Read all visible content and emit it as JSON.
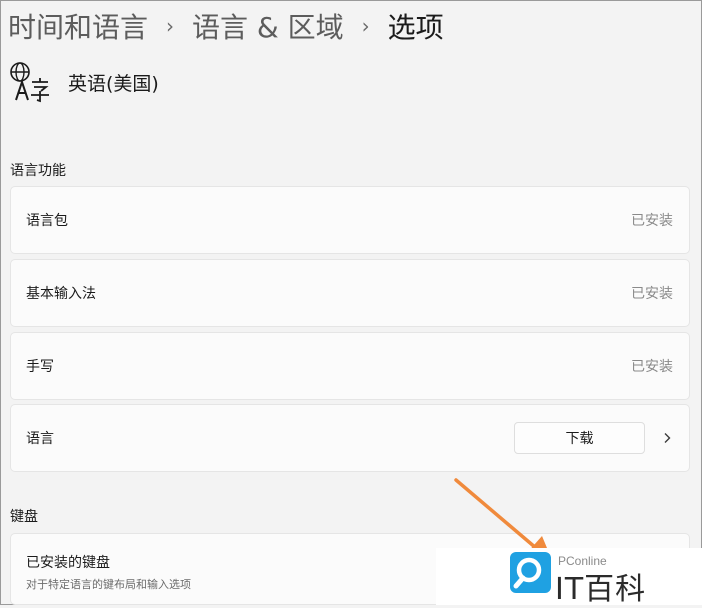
{
  "breadcrumb": {
    "level1": "时间和语言",
    "level2": "语言 & 区域",
    "current": "选项",
    "separator": "›"
  },
  "language": {
    "name": "英语(美国)",
    "icon": "language-glyph-icon"
  },
  "features": {
    "title": "语言功能",
    "items": [
      {
        "label": "语言包",
        "status": "已安装"
      },
      {
        "label": "基本输入法",
        "status": "已安装"
      },
      {
        "label": "手写",
        "status": "已安装"
      }
    ],
    "speech": {
      "label": "语言",
      "button": "下载"
    }
  },
  "keyboard": {
    "title": "键盘",
    "installed_title": "已安装的键盘",
    "installed_subtitle": "对于特定语言的键布局和输入选项"
  },
  "watermark": {
    "small": "PConline",
    "big": "IT百科"
  },
  "colors": {
    "annotation_arrow": "#f08a3c",
    "logo_blue": "#1fa1e2",
    "background": "#f3f3f3",
    "card": "#fbfbfb"
  }
}
